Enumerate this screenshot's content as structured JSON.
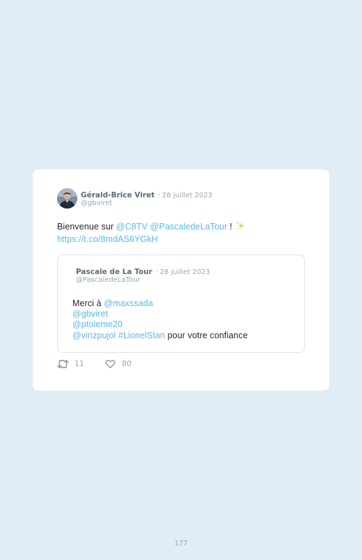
{
  "tweet": {
    "author_name": "Gérald-Brice Viret",
    "date": "· 28 juillet 2023",
    "handle": "@gbviret",
    "text": {
      "prefix": "Bienvenue sur ",
      "mention_1": "@C8TV",
      "mention_2": "@PascaledeLaTour",
      "suffix": " !",
      "emoji": "sparkles-emoji",
      "link": "https://t.co/8mdAS6YGkH"
    },
    "retweets": "11",
    "likes": "80"
  },
  "quoted_tweet": {
    "author_name": "Pascale de La Tour",
    "date": "· 28 juillet 2023",
    "handle": "@PascaledeLaTour",
    "text": {
      "prefix": "Merci à ",
      "mention_1": "@maxssada",
      "mention_2": "@gbviret",
      "mention_3": "@ptoleme20",
      "mention_4": "@vinzpujol",
      "hashtag": "#LionelStan",
      "suffix": " pour votre confiance"
    }
  },
  "page": {
    "number": "177"
  },
  "colors": {
    "background": "#e1edf5",
    "card": "#ffffff",
    "link": "#58b8e8",
    "text": "#1f2328",
    "muted": "#98a4b0"
  }
}
